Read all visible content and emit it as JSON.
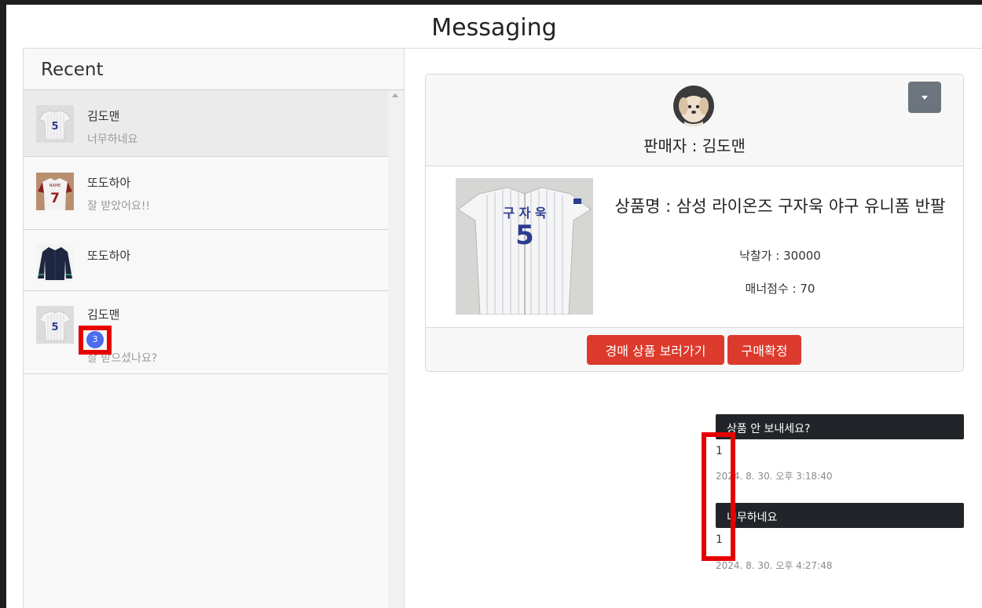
{
  "page": {
    "title": "Messaging"
  },
  "sidebar": {
    "title": "Recent",
    "chats": [
      {
        "name": "김도맨",
        "last_message": "너무하네요",
        "active": true,
        "thumb": "jersey-5-icon"
      },
      {
        "name": "또도하아",
        "last_message": "잘 받았어요!!",
        "active": false,
        "thumb": "jersey-7-icon"
      },
      {
        "name": "또도하아",
        "last_message": "",
        "active": false,
        "thumb": "jacket-icon"
      },
      {
        "name": "김도맨",
        "last_message": "잘 받으셨나요?",
        "active": false,
        "thumb": "jersey-5-icon",
        "unread_count": "3"
      }
    ]
  },
  "product_card": {
    "seller_label": "판매자 : 김도맨",
    "product_name": "상품명 : 삼성 라이온즈 구자욱 야구 유니폼 반팔",
    "price_label": "낙찰가 : 30000",
    "manner_label": "매너점수 : 70",
    "view_auction_button": "경매 상품 보러가기",
    "confirm_purchase_button": "구매확정",
    "dropdown_icon": "caret-down-icon",
    "jersey_text": "구 자 욱",
    "jersey_number": "5"
  },
  "messages": [
    {
      "text": "상품 안 보내세요?",
      "read_count": "1",
      "timestamp": "2024. 8. 30. 오후 3:18:40"
    },
    {
      "text": "너무하네요",
      "read_count": "1",
      "timestamp": "2024. 8. 30. 오후 4:27:48"
    }
  ],
  "colors": {
    "accent_red": "#dc3a2c",
    "bubble_dark": "#212529",
    "badge_blue": "#4a6cf0",
    "highlight_red": "#e60000"
  }
}
